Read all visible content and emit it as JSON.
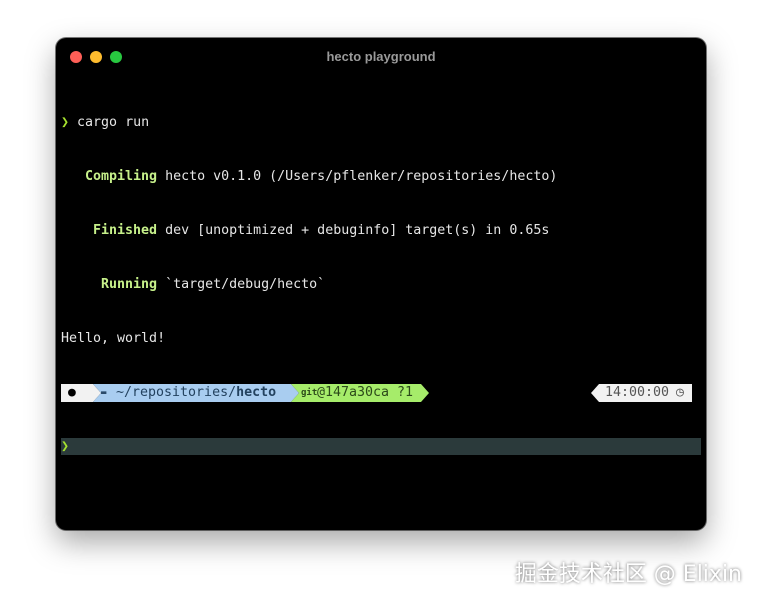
{
  "window": {
    "title": "hecto playground"
  },
  "terminal": {
    "command": "cargo run",
    "output": [
      {
        "status": "   Compiling",
        "text": " hecto v0.1.0 (/Users/pflenker/repositories/hecto)"
      },
      {
        "status": "    Finished",
        "text": " dev [unoptimized + debuginfo] target(s) in 0.65s"
      },
      {
        "status": "     Running",
        "text": " `target/debug/hecto`"
      }
    ],
    "program_output": "Hello, world!",
    "prompt": {
      "path_prefix": "~/repositories/",
      "path_dir": "hecto",
      "git_label": "git",
      "git_ref": "@147a30ca ?1",
      "time": "14:00:00",
      "prompt_char": "❯"
    }
  },
  "watermark": "掘金技术社区 @ Elixin",
  "colors": {
    "bg": "#000000",
    "green": "#c6f08a",
    "path_bg": "#a9cdf0",
    "git_bg": "#a6ec6a",
    "input_bg": "#2b3a3b"
  }
}
